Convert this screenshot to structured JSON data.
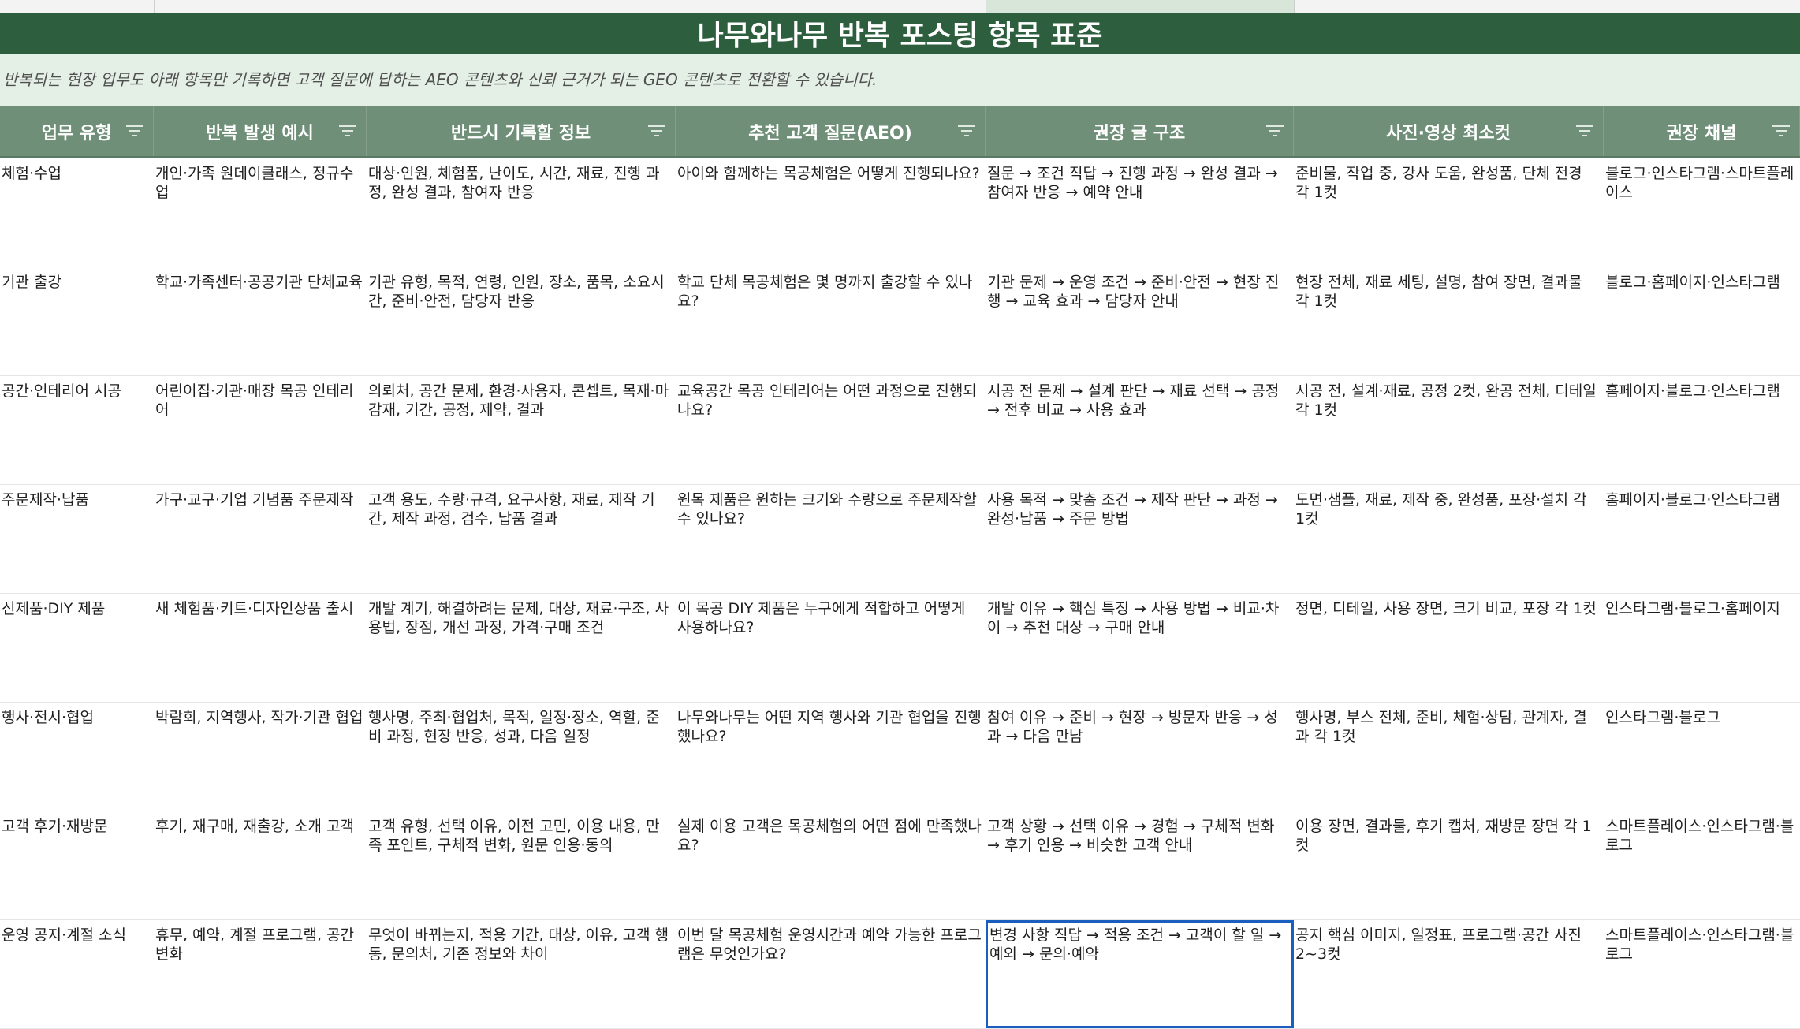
{
  "title": "나무와나무 반복 포스팅 항목 표준",
  "subtitle": "반복되는 현장 업무도 아래 항목만 기록하면 고객 질문에 답하는 AEO 콘텐츠와 신뢰 근거가 되는 GEO 콘텐츠로 전환할 수 있습니다.",
  "colors": {
    "title_bg": "#2d5e3d",
    "subtitle_bg": "#e4efe6",
    "header_bg": "#6f8f78",
    "selection": "#1a5fbf"
  },
  "headers": [
    "업무 유형",
    "반복 발생 예시",
    "반드시 기록할 정보",
    "추천 고객 질문(AEO)",
    "권장 글 구조",
    "사진·영상 최소컷",
    "권장 채널"
  ],
  "header_icon": "filter-icon",
  "rows": [
    [
      "체험·수업",
      "개인·가족 원데이클래스, 정규수업",
      "대상·인원, 체험품, 난이도, 시간, 재료, 진행 과정, 완성 결과, 참여자 반응",
      "아이와 함께하는 목공체험은 어떻게 진행되나요?",
      "질문 → 조건 직답 → 진행 과정 → 완성 결과 → 참여자 반응 → 예약 안내",
      "준비물, 작업 중, 강사 도움, 완성품, 단체 전경 각 1컷",
      "블로그·인스타그램·스마트플레이스"
    ],
    [
      "기관 출강",
      "학교·가족센터·공공기관 단체교육",
      "기관 유형, 목적, 연령, 인원, 장소, 품목, 소요시간, 준비·안전, 담당자 반응",
      "학교 단체 목공체험은 몇 명까지 출강할 수 있나요?",
      "기관 문제 → 운영 조건 → 준비·안전 → 현장 진행 → 교육 효과 → 담당자 안내",
      "현장 전체, 재료 세팅, 설명, 참여 장면, 결과물 각 1컷",
      "블로그·홈페이지·인스타그램"
    ],
    [
      "공간·인테리어 시공",
      "어린이집·기관·매장 목공 인테리어",
      "의뢰처, 공간 문제, 환경·사용자, 콘셉트, 목재·마감재, 기간, 공정, 제약, 결과",
      "교육공간 목공 인테리어는 어떤 과정으로 진행되나요?",
      "시공 전 문제 → 설계 판단 → 재료 선택 → 공정 → 전후 비교 → 사용 효과",
      "시공 전, 설계·재료, 공정 2컷, 완공 전체, 디테일 각 1컷",
      "홈페이지·블로그·인스타그램"
    ],
    [
      "주문제작·납품",
      "가구·교구·기업 기념품 주문제작",
      "고객 용도, 수량·규격, 요구사항, 재료, 제작 기간, 제작 과정, 검수, 납품 결과",
      "원목 제품은 원하는 크기와 수량으로 주문제작할 수 있나요?",
      "사용 목적 → 맞춤 조건 → 제작 판단 → 과정 → 완성·납품 → 주문 방법",
      "도면·샘플, 재료, 제작 중, 완성품, 포장·설치 각 1컷",
      "홈페이지·블로그·인스타그램"
    ],
    [
      "신제품·DIY 제품",
      "새 체험품·키트·디자인상품 출시",
      "개발 계기, 해결하려는 문제, 대상, 재료·구조, 사용법, 장점, 개선 과정, 가격·구매 조건",
      "이 목공 DIY 제품은 누구에게 적합하고 어떻게 사용하나요?",
      "개발 이유 → 핵심 특징 → 사용 방법 → 비교·차이 → 추천 대상 → 구매 안내",
      "정면, 디테일, 사용 장면, 크기 비교, 포장 각 1컷",
      "인스타그램·블로그·홈페이지"
    ],
    [
      "행사·전시·협업",
      "박람회, 지역행사, 작가·기관 협업",
      "행사명, 주최·협업처, 목적, 일정·장소, 역할, 준비 과정, 현장 반응, 성과, 다음 일정",
      "나무와나무는 어떤 지역 행사와 기관 협업을 진행했나요?",
      "참여 이유 → 준비 → 현장 → 방문자 반응 → 성과 → 다음 만남",
      "행사명, 부스 전체, 준비, 체험·상담, 관계자, 결과 각 1컷",
      "인스타그램·블로그"
    ],
    [
      "고객 후기·재방문",
      "후기, 재구매, 재출강, 소개 고객",
      "고객 유형, 선택 이유, 이전 고민, 이용 내용, 만족 포인트, 구체적 변화, 원문 인용·동의",
      "실제 이용 고객은 목공체험의 어떤 점에 만족했나요?",
      "고객 상황 → 선택 이유 → 경험 → 구체적 변화 → 후기 인용 → 비슷한 고객 안내",
      "이용 장면, 결과물, 후기 캡처, 재방문 장면 각 1컷",
      "스마트플레이스·인스타그램·블로그"
    ],
    [
      "운영 공지·계절 소식",
      "휴무, 예약, 계절 프로그램, 공간 변화",
      "무엇이 바뀌는지, 적용 기간, 대상, 이유, 고객 행동, 문의처, 기존 정보와 차이",
      "이번 달 목공체험 운영시간과 예약 가능한 프로그램은 무엇인가요?",
      "변경 사항 직답 → 적용 조건 → 고객이 할 일 → 예외 → 문의·예약",
      "공지 핵심 이미지, 일정표, 프로그램·공간 사진 2~3컷",
      "스마트플레이스·인스타그램·블로그"
    ]
  ]
}
